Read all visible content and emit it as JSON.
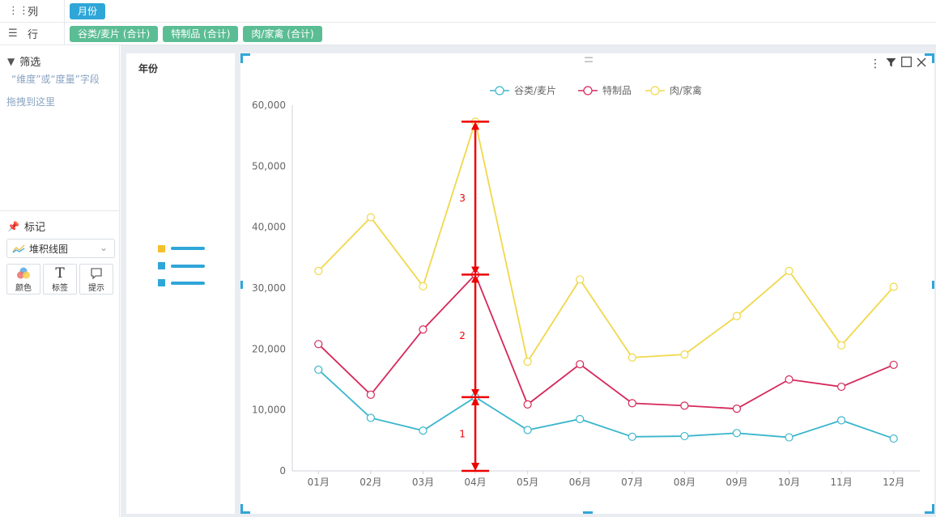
{
  "shelves": {
    "columns": {
      "label": "列",
      "icon": "columns-icon",
      "pills": [
        "月份"
      ]
    },
    "rows": {
      "label": "行",
      "icon": "rows-icon",
      "pills": [
        "谷类/麦片 (合计)",
        "特制品 (合计)",
        "肉/家禽 (合计)"
      ]
    }
  },
  "filter": {
    "title": "筛选",
    "hint_line1": "“维度”或“度量”字段",
    "hint_line2": "拖拽到这里"
  },
  "marks": {
    "title": "标记",
    "chart_type": "堆积线图",
    "buttons": [
      {
        "label": "颜色",
        "icon": "color-palette-icon"
      },
      {
        "label": "标签",
        "icon": "text-label-icon"
      },
      {
        "label": "提示",
        "icon": "tooltip-icon"
      }
    ]
  },
  "legend_panel": {
    "title": "年份"
  },
  "colors": {
    "accent": "#2fa6d8",
    "pill_green": "#5bbd94",
    "series1": "#3ab6cc",
    "series2": "#d6285b",
    "series3": "#f0d84a",
    "annotation": "#ee0000"
  },
  "annotations": [
    "1",
    "2",
    "3"
  ],
  "chart_data": {
    "type": "line",
    "stacked": true,
    "categories": [
      "01月",
      "02月",
      "03月",
      "04月",
      "05月",
      "06月",
      "07月",
      "08月",
      "09月",
      "10月",
      "11月",
      "12月"
    ],
    "series": [
      {
        "name": "谷类/麦片",
        "values": [
          16600,
          8700,
          6600,
          12100,
          6700,
          8500,
          5600,
          5700,
          6200,
          5500,
          8300,
          5300
        ]
      },
      {
        "name": "特制品",
        "values": [
          4200,
          3800,
          16600,
          20100,
          4200,
          9000,
          5500,
          5000,
          4000,
          9500,
          5500,
          12100
        ]
      },
      {
        "name": "肉/家禽",
        "values": [
          12000,
          29100,
          7100,
          25100,
          7000,
          13900,
          7500,
          8400,
          15200,
          17800,
          6800,
          12800
        ]
      }
    ],
    "y_ticks": [
      "0",
      "10,000",
      "20,000",
      "30,000",
      "40,000",
      "50,000",
      "60,000"
    ],
    "ylim": [
      0,
      60000
    ],
    "legend_position": "top",
    "grid": false
  }
}
